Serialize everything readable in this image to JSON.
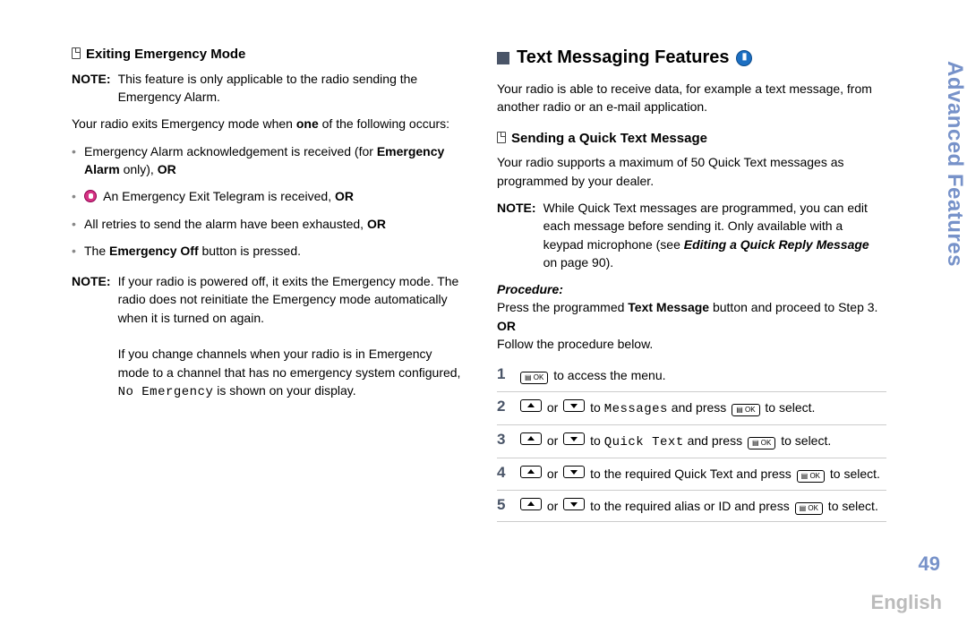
{
  "sideTab": "Advanced Features",
  "pageNumber": "49",
  "language": "English",
  "left": {
    "subhead": "Exiting Emergency Mode",
    "noteLabel": "NOTE:",
    "note1Body": "This feature is only applicable to the radio sending the Emergency Alarm.",
    "para1": "Your radio exits Emergency mode when one of the following occurs:",
    "b1a": "Emergency Alarm acknowledgement is received (for ",
    "b1b": "Emergency Alarm",
    "b1c": " only), ",
    "b1d": "OR",
    "b2a": "An Emergency Exit Telegram is received, ",
    "b2b": "OR",
    "b3a": "All retries to send the alarm have been exhausted, ",
    "b3b": "OR",
    "b4a": "The ",
    "b4b": "Emergency Off",
    "b4c": " button is pressed.",
    "note2Body": "If your radio is powered off, it exits the Emergency mode. The radio does not reinitiate the Emergency mode automatically when it is turned on again.",
    "note2Para2a": "If you change channels when your radio is in Emergency mode to a channel that has no emergency system configured, ",
    "note2Para2mono": "No Emergency",
    "note2Para2b": " is shown on your display."
  },
  "right": {
    "heading": "Text Messaging Features",
    "intro": "Your radio is able to receive data, for example a text message, from another radio or an e-mail application.",
    "subhead": "Sending a Quick Text Message",
    "para1": "Your radio supports a maximum of 50 Quick Text messages as programmed by your dealer.",
    "noteLabel": "NOTE:",
    "noteBody1": "While Quick Text messages are programmed, you can edit each message before sending it. Only available with a keypad microphone (see ",
    "noteBody1Ref": "Editing a Quick Reply Message",
    "noteBody1b": " on page 90).",
    "procLabel": "Procedure:",
    "procLine1a": "Press the programmed ",
    "procLine1b": "Text Message",
    "procLine1c": " button and proceed to Step 3.",
    "or": "OR",
    "procLine2": "Follow the procedure below.",
    "okKey": "▤ OK",
    "s1a": " to access the menu.",
    "s2a": " or ",
    "s2b": " to ",
    "s2menu": "Messages",
    "s2c": " and press ",
    "s2d": " to select.",
    "s3menu": "Quick Text",
    "s4a": " or ",
    "s4b": " to the required Quick Text and press ",
    "s4c": " to select.",
    "s5a": " or ",
    "s5b": " to the required alias or ID and press ",
    "s5c": " to select."
  }
}
